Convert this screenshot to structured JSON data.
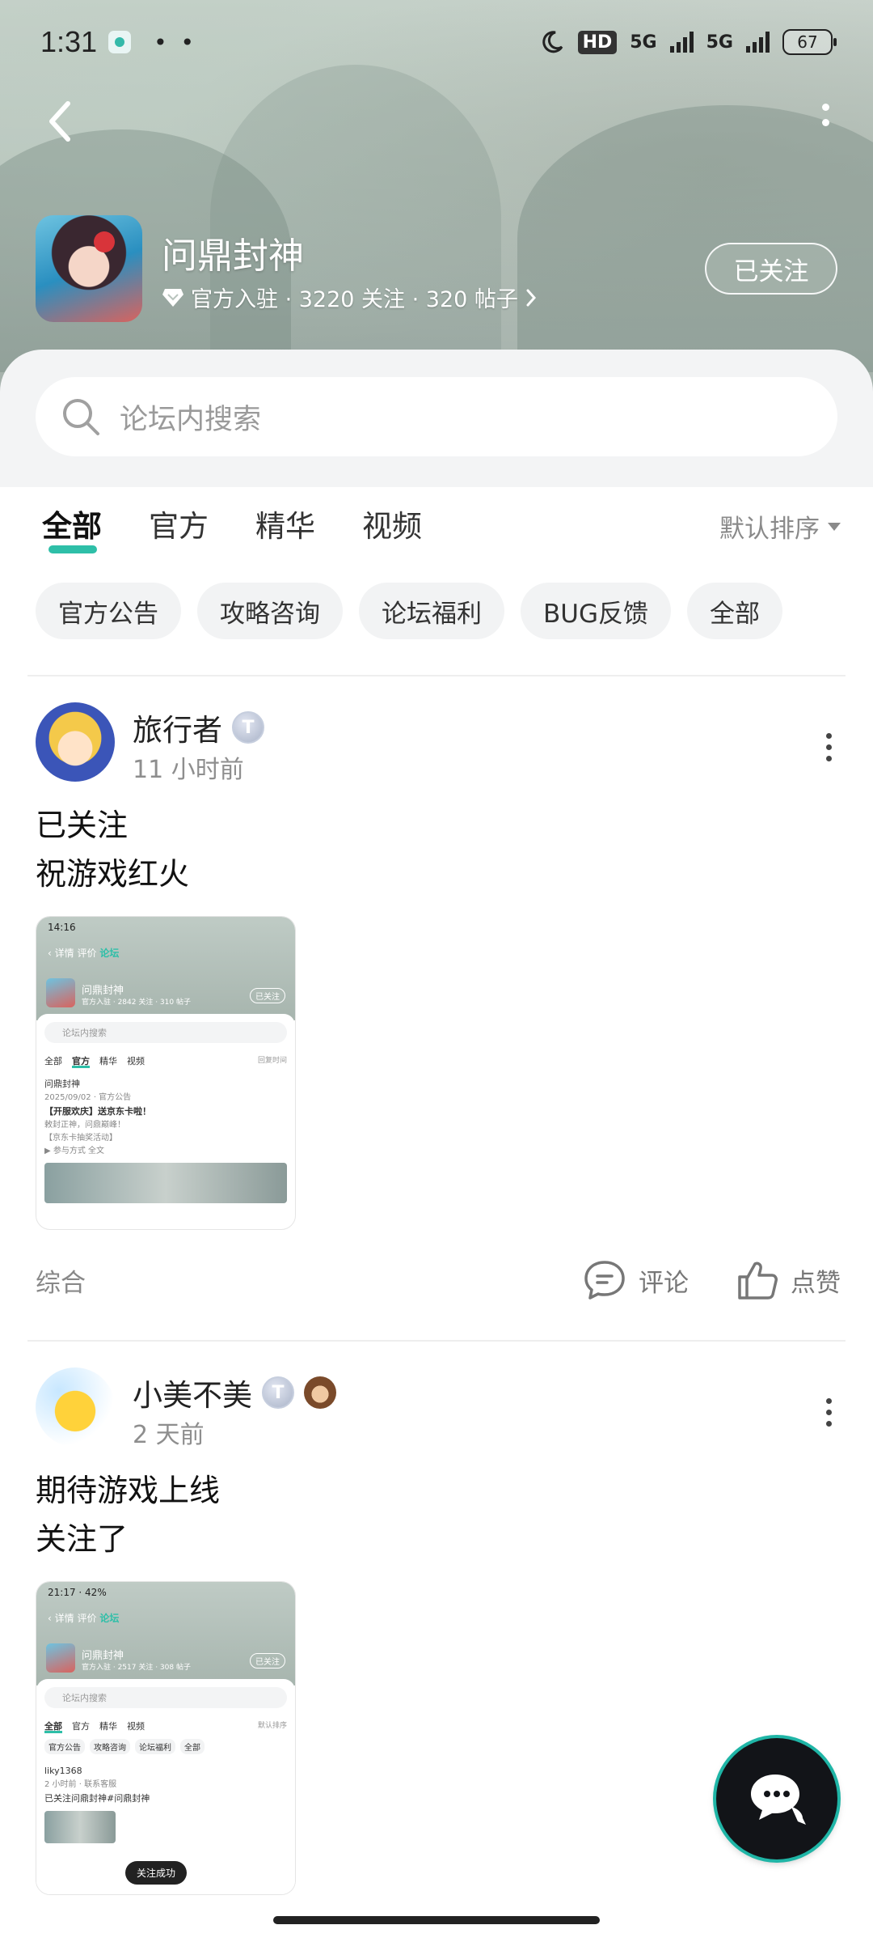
{
  "status_bar": {
    "time": "1:31",
    "dots": "• •",
    "hd": "HD",
    "network_1": "5G",
    "network_2": "5G",
    "battery": "67"
  },
  "forum": {
    "name": "问鼎封神",
    "meta": "官方入驻 · 3220 关注 · 320 帖子",
    "follow_label": "已关注"
  },
  "search": {
    "placeholder": "论坛内搜索"
  },
  "tabs": [
    {
      "label": "全部",
      "active": true
    },
    {
      "label": "官方",
      "active": false
    },
    {
      "label": "精华",
      "active": false
    },
    {
      "label": "视频",
      "active": false
    }
  ],
  "sort_label": "默认排序",
  "chips": [
    "官方公告",
    "攻略咨询",
    "论坛福利",
    "BUG反馈",
    "全部"
  ],
  "posts": [
    {
      "username": "旅行者",
      "time": "11 小时前",
      "lines": [
        "已关注",
        "祝游戏红火"
      ],
      "category": "综合",
      "comment_label": "评论",
      "like_label": "点赞",
      "screenshot": {
        "time": "14:16",
        "nav": [
          "详情",
          "评价",
          "论坛"
        ],
        "forum_name": "问鼎封神",
        "forum_meta": "官方入驻 · 2842 关注 · 310 帖子",
        "follow": "已关注",
        "search": "论坛内搜索",
        "tabs": [
          "全部",
          "官方",
          "精华",
          "视频"
        ],
        "sort": "回复时间",
        "author": "问鼎封神",
        "author_meta": "2025/09/02 · 官方公告",
        "title": "【开服欢庆】送京东卡啦！",
        "line2": "敕封正神，问鼎巅峰！",
        "line3": "【京东卡抽奖活动】",
        "line4": "▶ 参与方式  全文"
      }
    },
    {
      "username": "小美不美",
      "time": "2 天前",
      "lines": [
        "期待游戏上线",
        "关注了"
      ],
      "screenshot": {
        "time": "21:17",
        "battery": "42%",
        "nav": [
          "详情",
          "评价",
          "论坛"
        ],
        "forum_name": "问鼎封神",
        "forum_meta": "官方入驻 · 2517 关注 · 308 帖子",
        "follow": "已关注",
        "search": "论坛内搜索",
        "tabs": [
          "全部",
          "官方",
          "精华",
          "视频"
        ],
        "sort": "默认排序",
        "chips": [
          "官方公告",
          "攻略咨询",
          "论坛福利",
          "全部"
        ],
        "author": "liky1368",
        "author_meta": "2 小时前 · 联系客服",
        "text": "已关注问鼎封神#问鼎封神",
        "toast": "关注成功"
      }
    }
  ],
  "colors": {
    "accent": "#2ebfa8",
    "text": "#222222",
    "muted": "#8e8e8e"
  }
}
